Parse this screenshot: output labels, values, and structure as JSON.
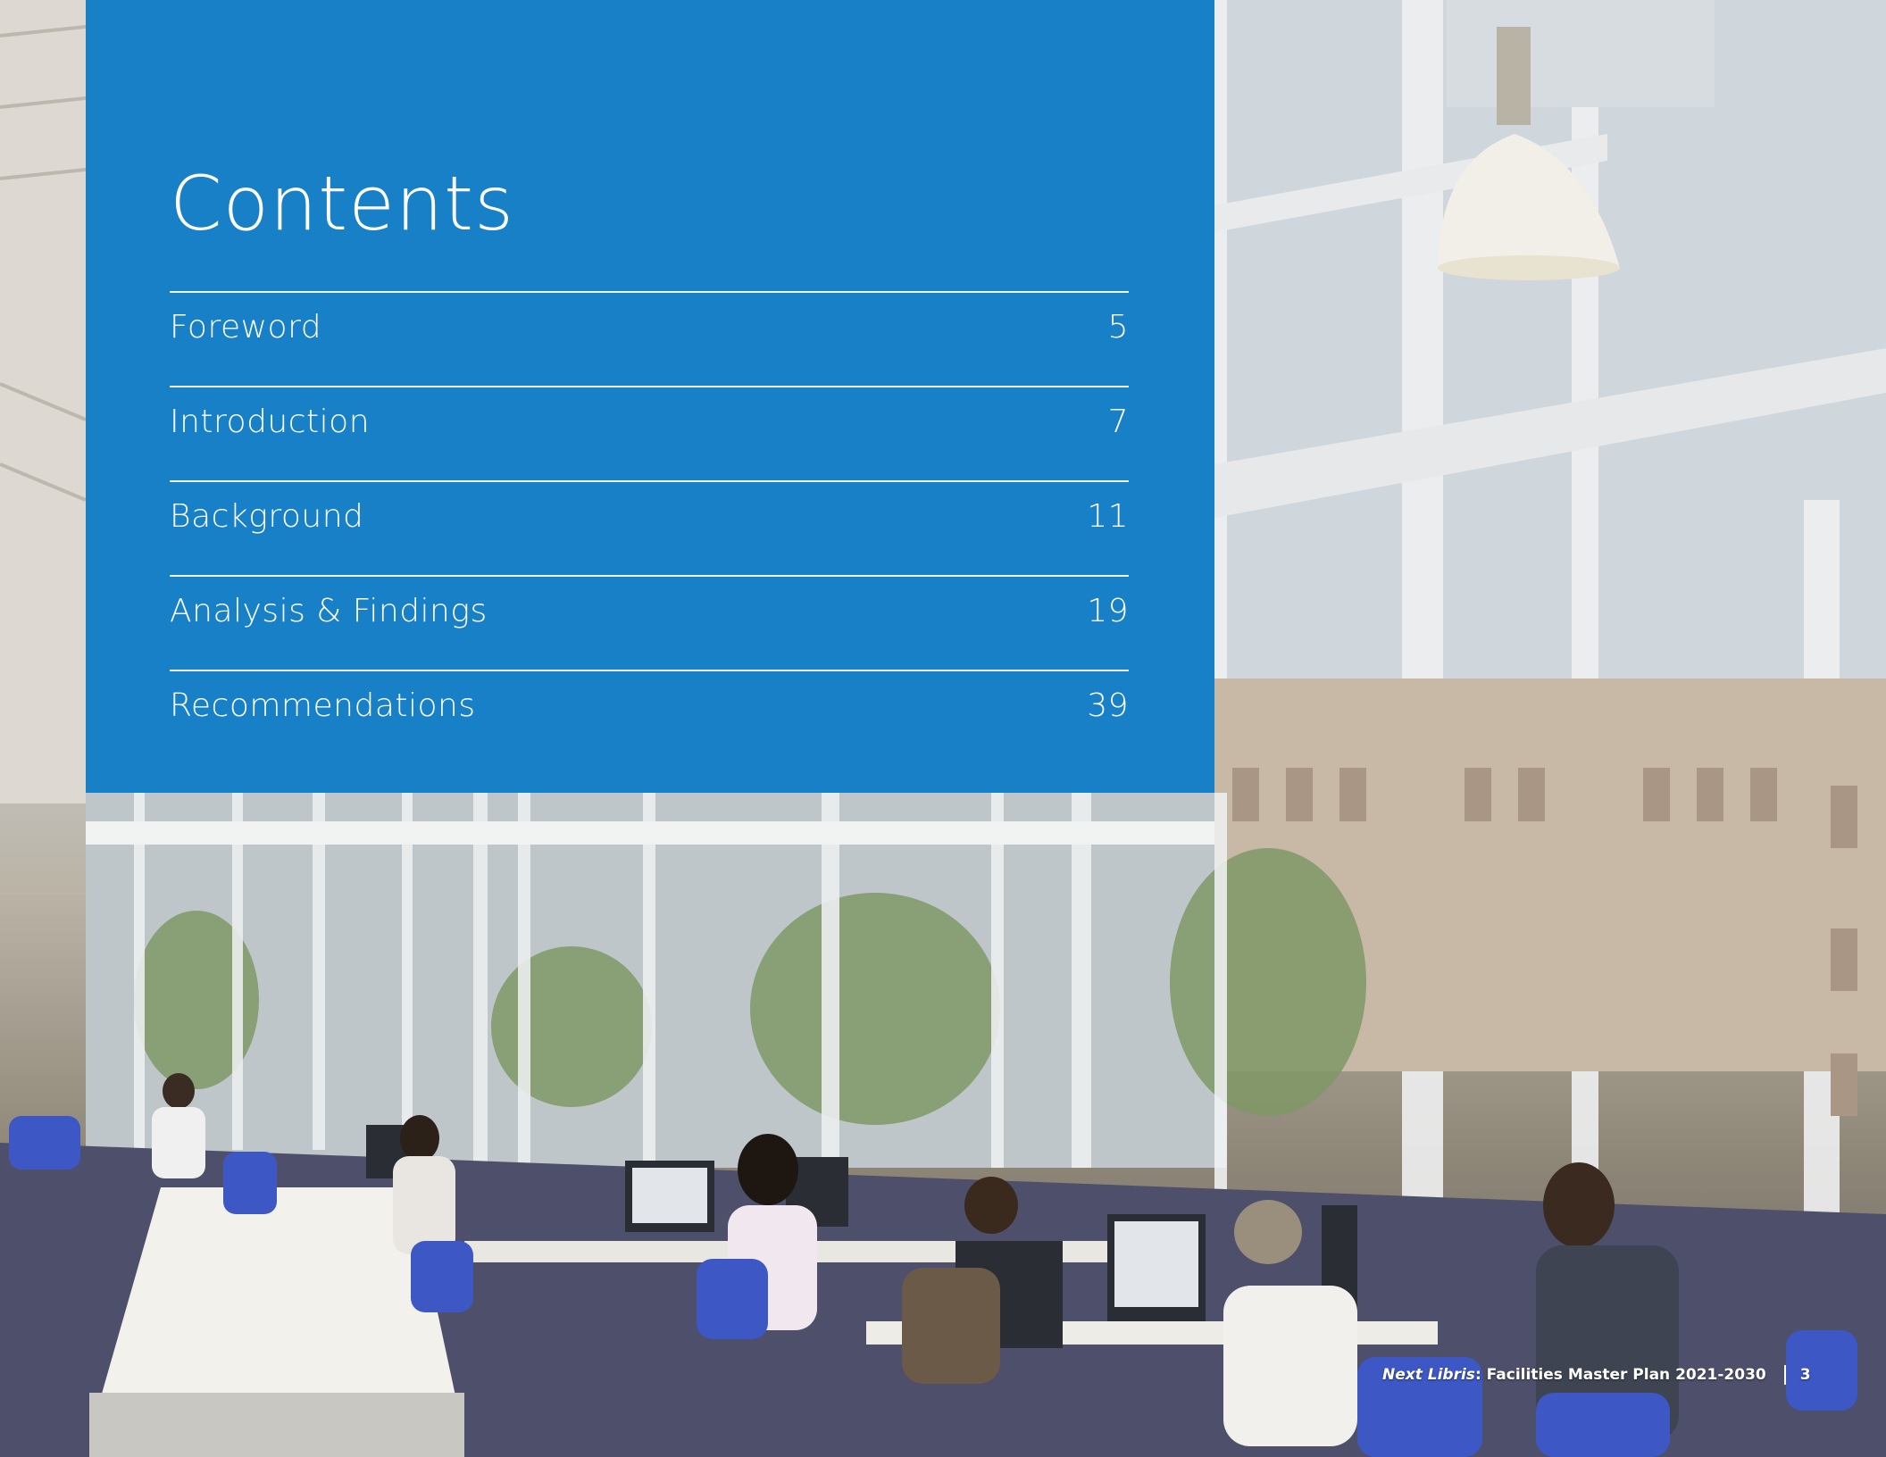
{
  "contents": {
    "title": "Contents",
    "entries": [
      {
        "label": "Foreword",
        "page": "5"
      },
      {
        "label": "Introduction",
        "page": "7"
      },
      {
        "label": "Background",
        "page": "11"
      },
      {
        "label": "Analysis & Findings",
        "page": "19"
      },
      {
        "label": "Recommendations",
        "page": "39"
      }
    ]
  },
  "footer": {
    "title_italic": "Next Libris",
    "title_rest": ": Facilities Master Plan 2021-2030",
    "page_number": "3"
  },
  "colors": {
    "panel_blue": "#1880c6",
    "text": "#ffffff"
  }
}
